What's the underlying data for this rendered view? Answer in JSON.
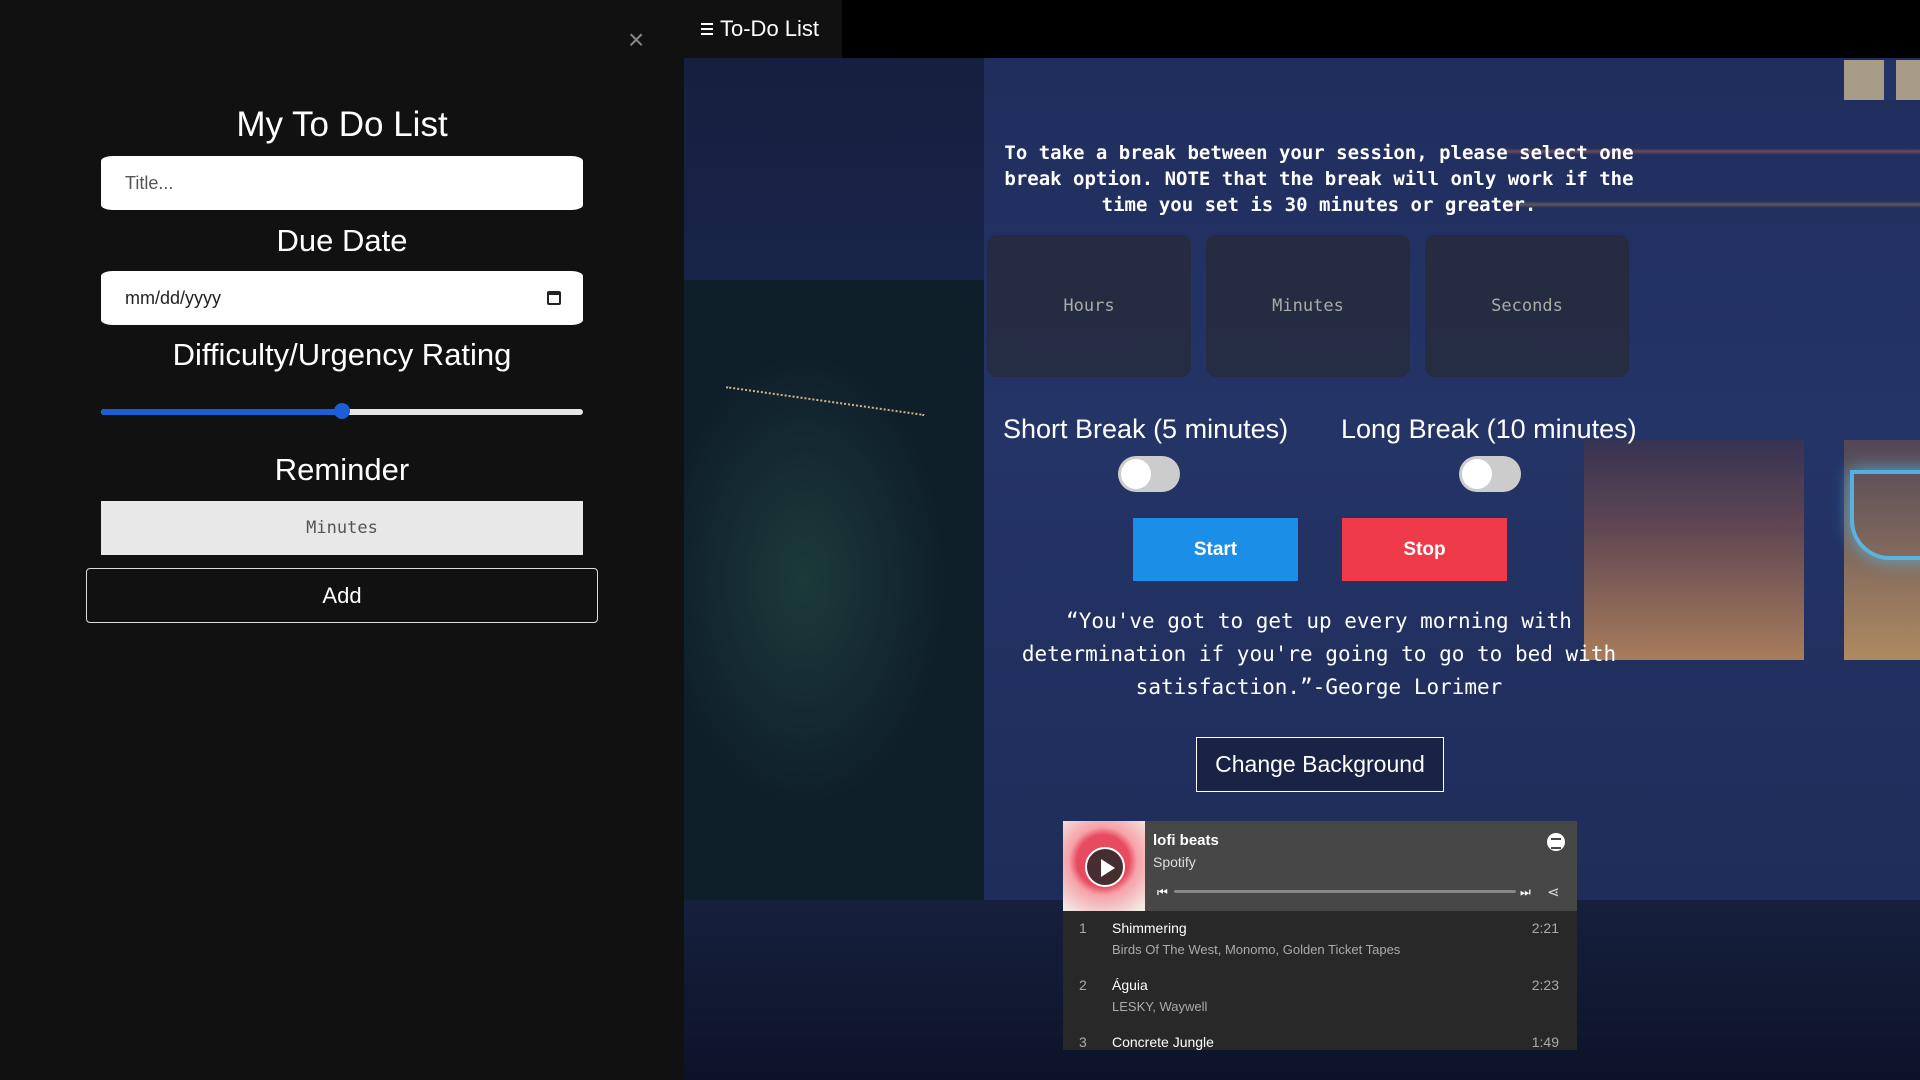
{
  "topbar": {
    "toggle_label": "To-Do List"
  },
  "sidebar": {
    "close_glyph": "×",
    "heading": "My To Do List",
    "title_placeholder": "Title...",
    "due_date_heading": "Due Date",
    "due_date_value": "mm/dd/yyyy",
    "rating_heading": "Difficulty/Urgency Rating",
    "rating_value": 0.5,
    "reminder_heading": "Reminder",
    "reminder_placeholder": "Minutes",
    "add_label": "Add"
  },
  "main": {
    "notice": "To take a break between your session, please select one break option. NOTE that the break will only work if the time you set is 30 minutes or greater.",
    "timer": {
      "hours": "Hours",
      "minutes": "Minutes",
      "seconds": "Seconds"
    },
    "short_break_label": "Short Break (5 minutes)",
    "long_break_label": "Long Break (10 minutes)",
    "short_break_on": false,
    "long_break_on": false,
    "start_label": "Start",
    "stop_label": "Stop",
    "quote": "“You've got to get up every morning with determination if you're going to go to bed with satisfaction.”-George Lorimer",
    "change_bg_label": "Change Background",
    "colors": {
      "start": "#1b8fe8",
      "stop": "#ef3a4a",
      "slider": "#1a5fd6"
    }
  },
  "player": {
    "title": "lofi beats",
    "subtitle": "Spotify",
    "icons": [
      "play-icon",
      "spotify-logo-icon",
      "previous-track-icon",
      "next-track-icon",
      "share-icon"
    ],
    "tracks": [
      {
        "num": "1",
        "name": "Shimmering",
        "artists": "Birds Of The West, Monomo, Golden Ticket Tapes",
        "duration": "2:21"
      },
      {
        "num": "2",
        "name": "Águia",
        "artists": "LESKY, Waywell",
        "duration": "2:23"
      },
      {
        "num": "3",
        "name": "Concrete Jungle",
        "artists": "",
        "duration": "1:49"
      }
    ]
  }
}
